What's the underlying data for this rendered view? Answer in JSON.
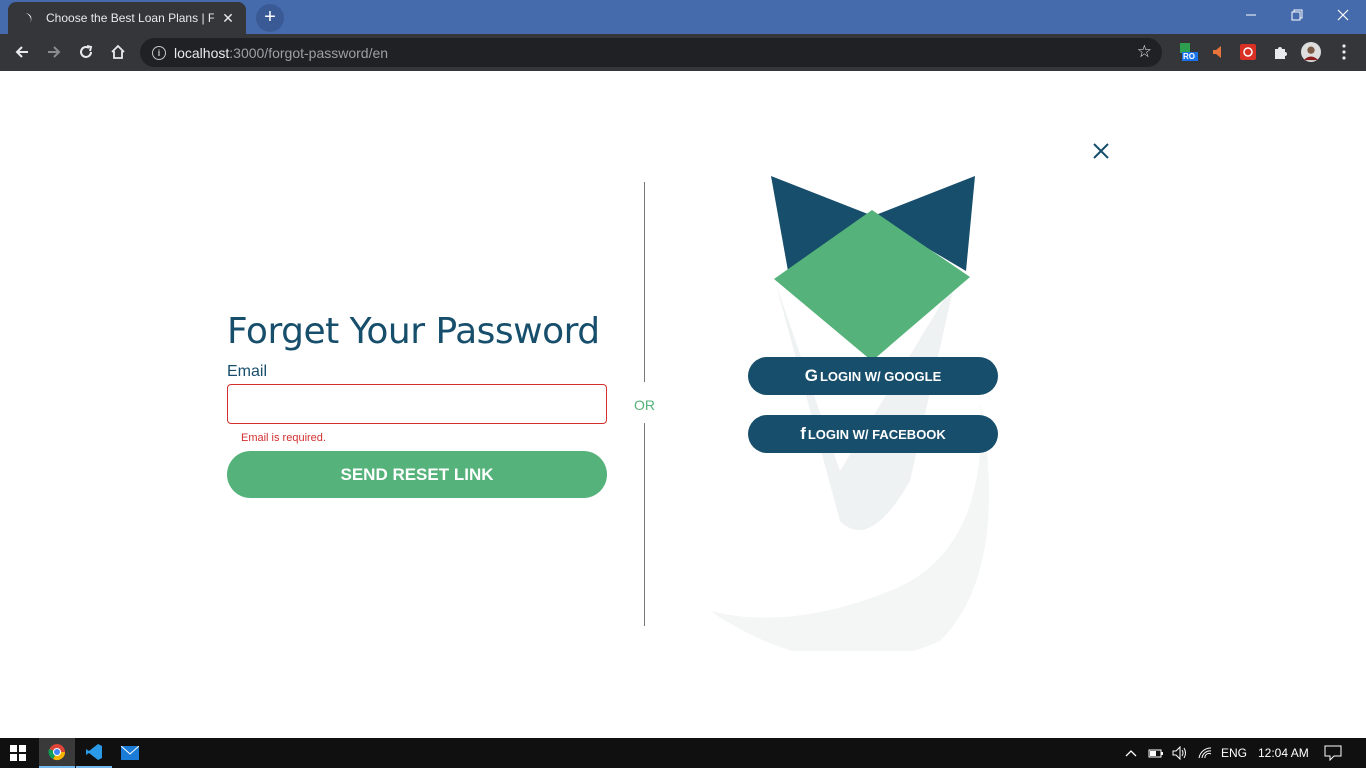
{
  "browser": {
    "tab_title": "Choose the Best Loan Plans | Fay",
    "url_host": "localhost",
    "url_rest": ":3000/forgot-password/en",
    "new_tab": "+",
    "tab_close": "✕",
    "ext_badge": "RO"
  },
  "form": {
    "title": "Forget Your Password",
    "email_label": "Email",
    "email_value": "",
    "email_error": "Email is required.",
    "submit_label": "SEND RESET LINK",
    "or_label": "OR"
  },
  "social": {
    "google_icon": "G",
    "google_label": "LOGIN W/ GOOGLE",
    "facebook_icon": "f",
    "facebook_label": "LOGIN W/ FACEBOOK"
  },
  "taskbar": {
    "language": "ENG",
    "time": "12:04 AM"
  },
  "colors": {
    "brand_dark": "#174e6b",
    "brand_green": "#55b27a",
    "error": "#d32f2f"
  }
}
